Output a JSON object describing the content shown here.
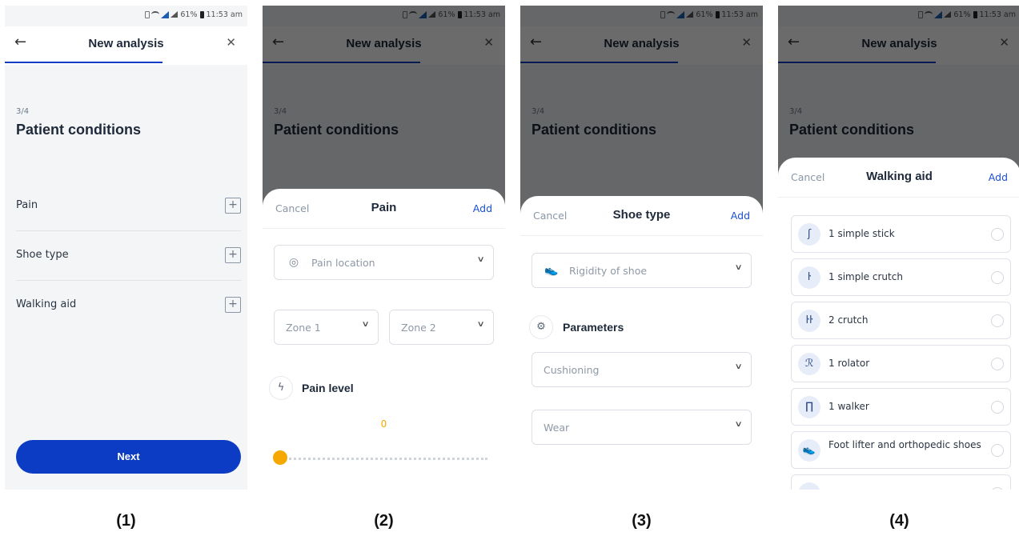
{
  "status_bar": {
    "battery": "61%",
    "time": "11:53 am"
  },
  "header": {
    "title": "New analysis"
  },
  "page": {
    "step": "3/4",
    "title": "Patient conditions"
  },
  "conditions": [
    {
      "label": "Pain"
    },
    {
      "label": "Shoe type"
    },
    {
      "label": "Walking aid"
    }
  ],
  "next_button": "Next",
  "pain_sheet": {
    "cancel": "Cancel",
    "title": "Pain",
    "add": "Add",
    "location_placeholder": "Pain location",
    "zone1": "Zone 1",
    "zone2": "Zone 2",
    "level_label": "Pain level",
    "level_value": "0",
    "level_fraction": 0,
    "slider_steps": 11
  },
  "shoe_sheet": {
    "cancel": "Cancel",
    "title": "Shoe type",
    "add": "Add",
    "rigidity_placeholder": "Rigidity of shoe",
    "parameters_label": "Parameters",
    "cushioning_placeholder": "Cushioning",
    "wear_placeholder": "Wear"
  },
  "aid_sheet": {
    "cancel": "Cancel",
    "title": "Walking aid",
    "add": "Add",
    "items": [
      {
        "label": "1 simple stick",
        "icon": "cane-icon"
      },
      {
        "label": "1 simple crutch",
        "icon": "crutch-icon"
      },
      {
        "label": "2 crutch",
        "icon": "two-crutches-icon"
      },
      {
        "label": "1 rolator",
        "icon": "rollator-icon"
      },
      {
        "label": "1 walker",
        "icon": "walker-icon"
      },
      {
        "label": "Foot lifter and orthopedic shoes",
        "icon": "shoe-icon"
      }
    ]
  },
  "captions": [
    "(1)",
    "(2)",
    "(3)",
    "(4)"
  ],
  "colors": {
    "primary": "#0d3cc4",
    "accent_orange": "#f5a800",
    "link_blue": "#1a4fd1"
  }
}
